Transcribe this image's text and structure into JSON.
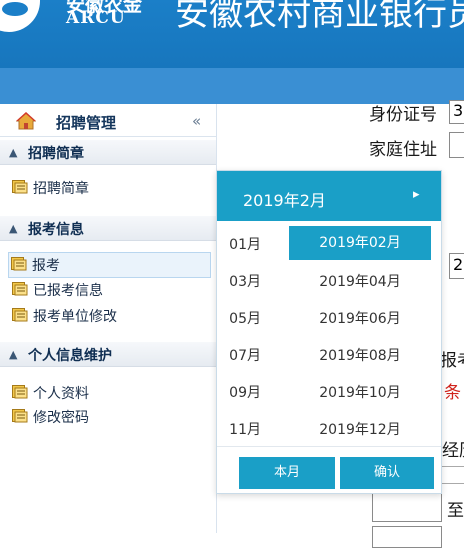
{
  "header": {
    "logo_cn": "安徽农金",
    "logo_en": "ARCU",
    "site_title": "安徽农村商业银行员工"
  },
  "sidebar": {
    "title": "招聘管理",
    "collapse_glyph": "«",
    "groups": [
      {
        "label": "招聘简章",
        "items": [
          "招聘简章"
        ]
      },
      {
        "label": "报考信息",
        "items": [
          "报考",
          "已报考信息",
          "报考单位修改"
        ]
      },
      {
        "label": "个人信息维护",
        "items": [
          "个人资料",
          "修改密码"
        ]
      }
    ]
  },
  "form": {
    "id_label": "身份证号",
    "id_value_start": "3",
    "address_label": "家庭住址",
    "partial_value_2": "2",
    "partial_label_kao": "报考",
    "partial_red": "条",
    "partial_label_jing": "经历",
    "partial_label_zhi": "至"
  },
  "date_picker": {
    "title": "2019年2月",
    "next_glyph": "▸",
    "left_months": [
      "01月",
      "03月",
      "05月",
      "07月",
      "09月",
      "11月"
    ],
    "right_months": [
      "2019年02月",
      "2019年04月",
      "2019年06月",
      "2019年08月",
      "2019年10月",
      "2019年12月"
    ],
    "active": "2019年02月",
    "btn_current": "本月",
    "btn_confirm": "确认"
  },
  "colors": {
    "header_blue": "#1b7fc8",
    "bar_blue": "#3a8fd3",
    "picker_teal": "#1a9fc7"
  }
}
